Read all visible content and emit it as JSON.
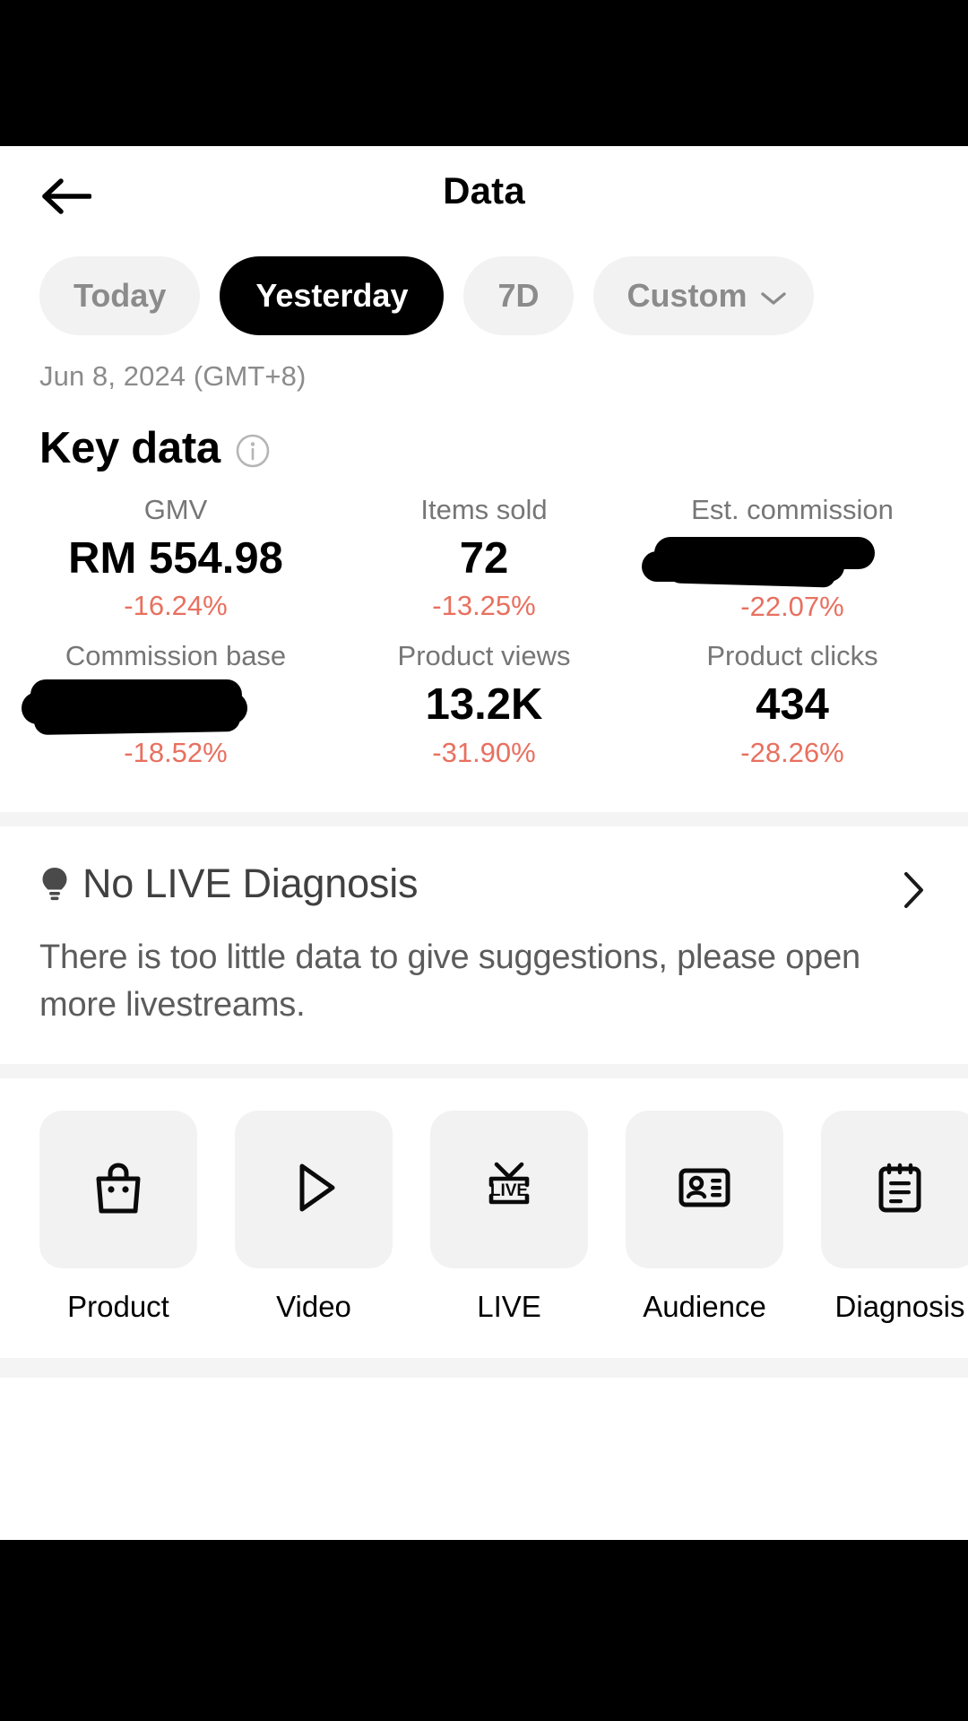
{
  "header": {
    "title": "Data",
    "back_icon": "arrow-left-icon"
  },
  "period_tabs": [
    {
      "label": "Today",
      "active": false,
      "has_chevron": false
    },
    {
      "label": "Yesterday",
      "active": true,
      "has_chevron": false
    },
    {
      "label": "7D",
      "active": false,
      "has_chevron": false
    },
    {
      "label": "Custom",
      "active": false,
      "has_chevron": true
    }
  ],
  "date_line": "Jun 8, 2024 (GMT+8)",
  "key_data": {
    "title": "Key data",
    "info_icon": "info-circle-icon",
    "metrics": [
      {
        "label": "GMV",
        "value": "RM 554.98",
        "delta": "-16.24%",
        "redacted": false
      },
      {
        "label": "Items sold",
        "value": "72",
        "delta": "-13.25%",
        "redacted": false
      },
      {
        "label": "Est. commission",
        "value": "",
        "delta": "-22.07%",
        "redacted": true
      },
      {
        "label": "Commission base",
        "value": "",
        "delta": "-18.52%",
        "redacted": true
      },
      {
        "label": "Product views",
        "value": "13.2K",
        "delta": "-31.90%",
        "redacted": false
      },
      {
        "label": "Product clicks",
        "value": "434",
        "delta": "-28.26%",
        "redacted": false
      }
    ],
    "delta_color": "#e8705f"
  },
  "diagnosis": {
    "icon": "lightbulb-icon",
    "title": "No LIVE Diagnosis",
    "body": "There is too little data to give suggestions, please open more livestreams.",
    "chevron_icon": "chevron-right-icon"
  },
  "shortcuts": [
    {
      "label": "Product",
      "icon": "shopping-bag-icon"
    },
    {
      "label": "Video",
      "icon": "play-triangle-icon"
    },
    {
      "label": "LIVE",
      "icon": "live-tv-icon"
    },
    {
      "label": "Audience",
      "icon": "id-card-icon"
    },
    {
      "label": "Diagnosis",
      "icon": "clipboard-icon"
    }
  ]
}
